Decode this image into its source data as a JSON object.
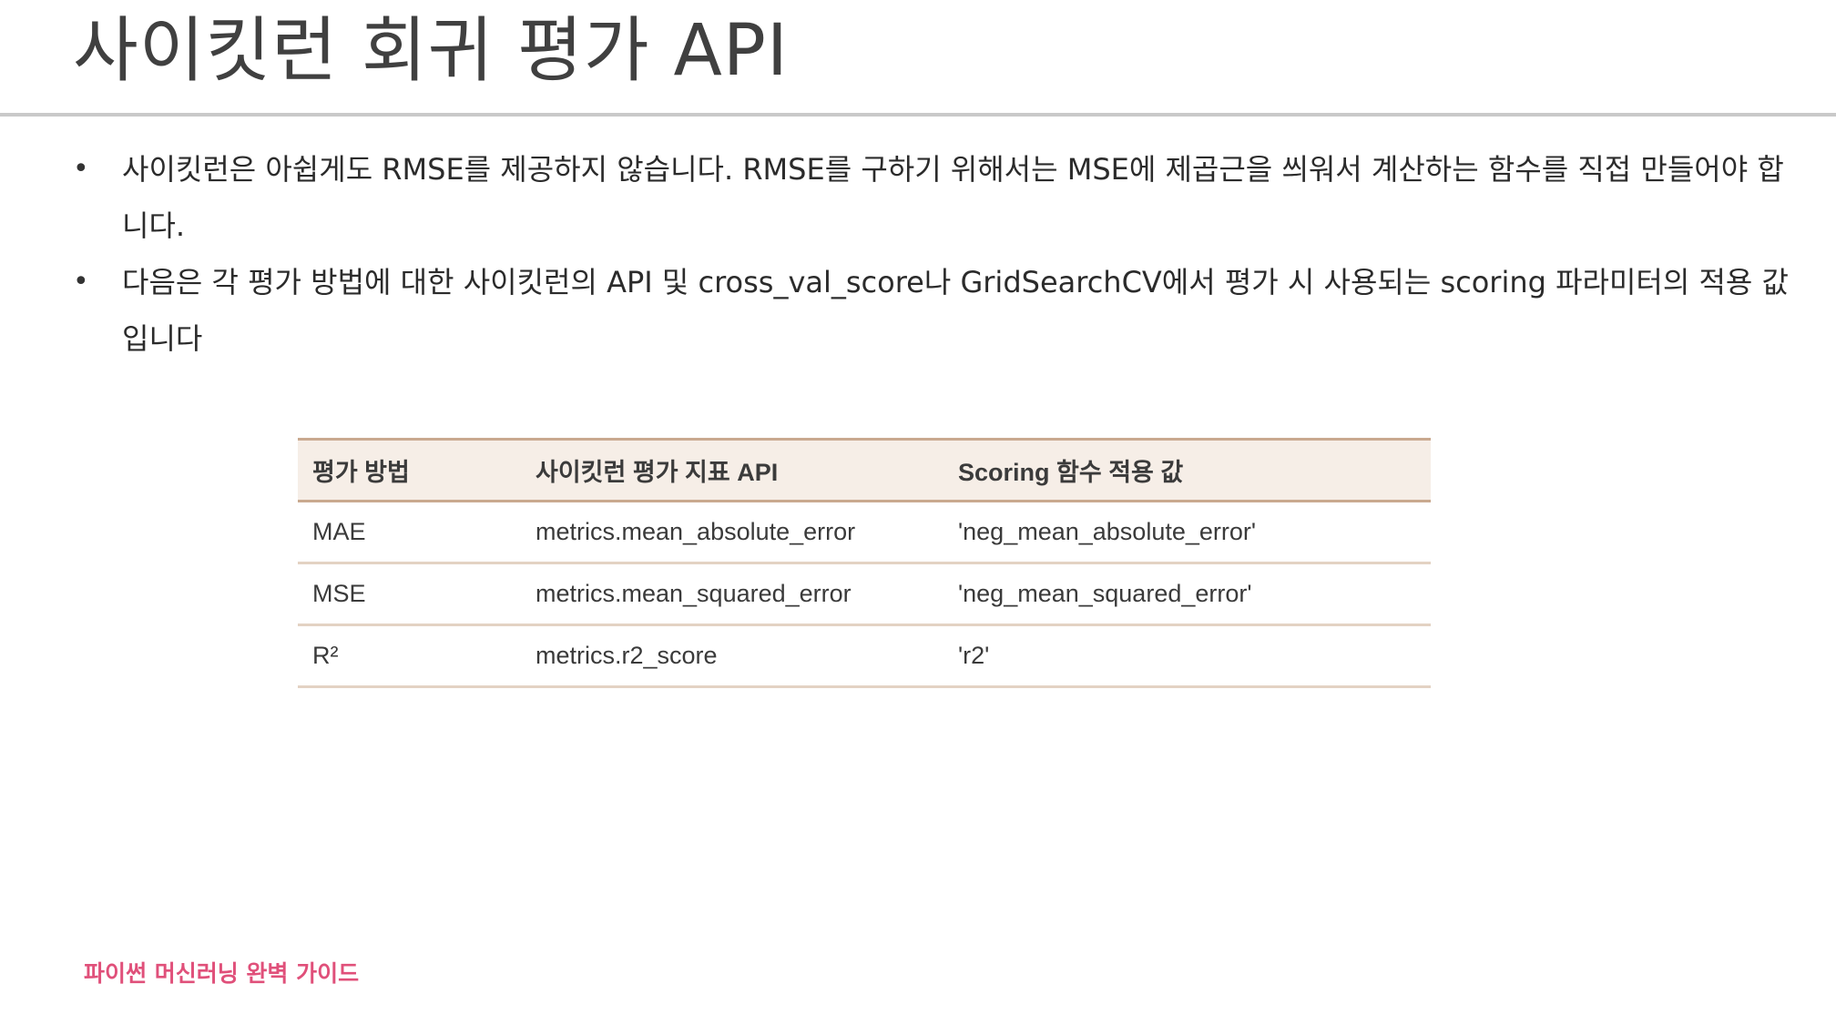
{
  "slide": {
    "title": "사이킷런 회귀 평가 API",
    "bullets": [
      "사이킷런은 아쉽게도 RMSE를 제공하지 않습니다. RMSE를 구하기 위해서는 MSE에 제곱근을 씌워서 계산하는 함수를 직접 만들어야 합니다.",
      "다음은 각 평가 방법에 대한 사이킷런의 API 및 cross_val_score나 GridSearchCV에서 평가 시 사용되는 scoring 파라미터의 적용 값입니다"
    ],
    "table": {
      "headers": [
        "평가 방법",
        "사이킷런 평가 지표 API",
        "Scoring 함수 적용 값"
      ],
      "rows": [
        [
          "MAE",
          "metrics.mean_absolute_error",
          "'neg_mean_absolute_error'"
        ],
        [
          "MSE",
          "metrics.mean_squared_error",
          "'neg_mean_squared_error'"
        ],
        [
          "R²",
          "metrics.r2_score",
          "'r2'"
        ]
      ]
    },
    "footer": "파이썬 머신러닝 완벽 가이드",
    "colors": {
      "footer_accent": "#e0507a",
      "table_header_bg": "#f6eee7",
      "table_rule": "#c9a98f"
    }
  }
}
